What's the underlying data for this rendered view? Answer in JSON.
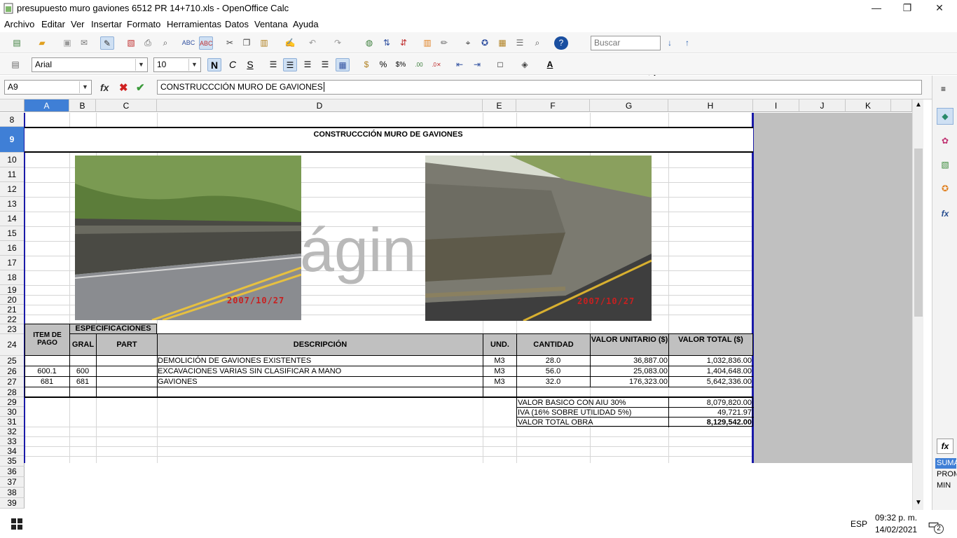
{
  "window": {
    "title": "presupuesto muro gaviones 6512 PR 14+710.xls - OpenOffice Calc",
    "minimize": "—",
    "restore": "❐",
    "close": "✕"
  },
  "menu": [
    "Archivo",
    "Editar",
    "Ver",
    "Insertar",
    "Formato",
    "Herramientas",
    "Datos",
    "Ventana",
    "Ayuda"
  ],
  "toolbar": {
    "search_placeholder": "Buscar"
  },
  "format": {
    "font_name": "Arial",
    "font_size": "10",
    "bold": "N",
    "italic": "C",
    "underline": "S"
  },
  "formula": {
    "cell_ref": "A9",
    "content": "CONSTRUCCCIÓN MURO DE GAVIONES"
  },
  "columns": [
    "A",
    "B",
    "C",
    "D",
    "E",
    "F",
    "G",
    "H",
    "I",
    "J",
    "K"
  ],
  "rows": [
    "8",
    "9",
    "10",
    "11",
    "12",
    "13",
    "14",
    "15",
    "16",
    "17",
    "18",
    "19",
    "20",
    "21",
    "22",
    "23",
    "24",
    "25",
    "26",
    "27",
    "28",
    "29",
    "30",
    "31",
    "32",
    "33",
    "34",
    "35",
    "36",
    "37",
    "38",
    "39"
  ],
  "sheet": {
    "heading": "CONSTRUCCCIÓN MURO DE GAVIONES",
    "watermark": "ágin",
    "photo_date_1": "2007/10/27",
    "photo_date_2": "2007/10/27",
    "headers": {
      "item": "ITEM DE PAGO",
      "especificaciones": "ESPECIFICACIONES",
      "gral": "GRAL",
      "part": "PART",
      "descripcion": "DESCRIPCIÓN",
      "und": "UND.",
      "cantidad": "CANTIDAD",
      "valor_unitario": "VALOR UNITARIO ($)",
      "valor_total": "VALOR TOTAL ($)"
    },
    "items": [
      {
        "item": "",
        "gral": "",
        "desc": "DEMOLICIÓN DE GAVIONES  EXISTENTES",
        "und": "M3",
        "cant": "28.0",
        "vu": "36,887.00",
        "vt": "1,032,836.00"
      },
      {
        "item": "600.1",
        "gral": "600",
        "desc": "EXCAVACIONES VARIAS SIN CLASIFICAR    A MANO",
        "und": "M3",
        "cant": "56.0",
        "vu": "25,083.00",
        "vt": "1,404,648.00"
      },
      {
        "item": "681",
        "gral": "681",
        "desc": "GAVIONES",
        "und": "M3",
        "cant": "32.0",
        "vu": "176,323.00",
        "vt": "5,642,336.00"
      }
    ],
    "totals": [
      {
        "label": "VALOR BASICO CON AIU 30%",
        "value": "8,079,820.00"
      },
      {
        "label": "IVA (16% SOBRE UTILIDAD 5%)",
        "value": "49,721.97"
      },
      {
        "label": "VALOR TOTAL OBRA",
        "value": "8,129,542.00"
      }
    ]
  },
  "sidebar_functions": [
    "SUMA",
    "PROM",
    "MIN"
  ],
  "taskbar": {
    "lang": "ESP",
    "time": "09:32 p. m.",
    "date": "14/02/2021",
    "notif_count": "2"
  }
}
